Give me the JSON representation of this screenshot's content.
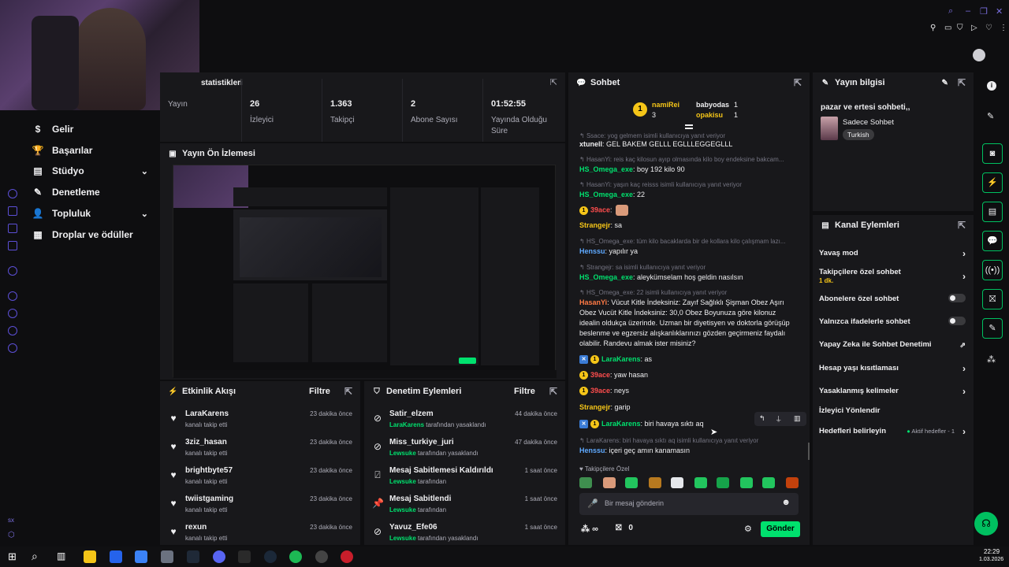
{
  "sidebar": {
    "items": [
      {
        "label": "Gelir",
        "icon": "dollar-icon"
      },
      {
        "label": "Başarılar",
        "icon": "trophy-icon"
      },
      {
        "label": "Stüdyo",
        "icon": "studio-icon"
      },
      {
        "label": "Denetleme",
        "icon": "wrench-icon"
      },
      {
        "label": "Topluluk",
        "icon": "person-icon"
      },
      {
        "label": "Droplar ve ödüller",
        "icon": "gift-icon"
      }
    ],
    "bottom_label": "sx"
  },
  "stats": {
    "title": "statistikleri",
    "items": [
      {
        "value": "",
        "label": "Yayın"
      },
      {
        "value": "26",
        "label": "İzleyici"
      },
      {
        "value": "1.363",
        "label": "Takipçi"
      },
      {
        "value": "2",
        "label": "Abone Sayısı"
      },
      {
        "value": "01:52:55",
        "label": "Yayında Olduğu Süre"
      }
    ]
  },
  "preview": {
    "title": "Yayın Ön İzlemesi"
  },
  "activity": {
    "title": "Etkinlik Akışı",
    "filter": "Filtre",
    "rows": [
      {
        "name": "LaraKarens",
        "sub": "kanalı takip etti",
        "time": "23 dakika önce"
      },
      {
        "name": "3ziz_hasan",
        "sub": "kanalı takip etti",
        "time": "23 dakika önce"
      },
      {
        "name": "brightbyte57",
        "sub": "kanalı takip etti",
        "time": "23 dakika önce"
      },
      {
        "name": "twiistgaming",
        "sub": "kanalı takip etti",
        "time": "23 dakika önce"
      },
      {
        "name": "rexun",
        "sub": "kanalı takip etti",
        "time": "23 dakika önce"
      }
    ]
  },
  "moderation": {
    "title": "Denetim Eylemleri",
    "filter": "Filtre",
    "rows": [
      {
        "name": "Satir_elzem",
        "actor": "LaraKarens",
        "rest": "tarafından yasaklandı",
        "time": "44 dakika önce",
        "icon": "ban-icon"
      },
      {
        "name": "Miss_turkiye_juri",
        "actor": "Lewsuke",
        "rest": "tarafından yasaklandı",
        "time": "47 dakika önce",
        "icon": "ban-icon"
      },
      {
        "name": "Mesaj Sabitlemesi Kaldırıldı",
        "actor": "Lewsuke",
        "rest": "tarafından",
        "time": "1 saat önce",
        "icon": "unpin-icon"
      },
      {
        "name": "Mesaj Sabitlendi",
        "actor": "Lewsuke",
        "rest": "tarafından",
        "time": "1 saat önce",
        "icon": "pin-icon"
      },
      {
        "name": "Yavuz_Efe06",
        "actor": "Lewsuke",
        "rest": "tarafından yasaklandı",
        "time": "1 saat önce",
        "icon": "ban-icon"
      }
    ]
  },
  "chat": {
    "title": "Sohbet",
    "leaderboard": [
      {
        "rank": "1",
        "name": "namiRei",
        "count": "3"
      },
      {
        "rank": "",
        "name": "babyodas",
        "count": "1"
      },
      {
        "rank": "",
        "name": "opakisu",
        "count": "1"
      }
    ],
    "messages": [
      {
        "type": "reply",
        "text": "Ssace: yog gelmem isimli kullanıcıya yanıt veriyor"
      },
      {
        "type": "msg",
        "user": "xtunell",
        "color": "#efeff1",
        "text": ": GEL BAKEM GELLL EGLLLEGGEGLLL"
      },
      {
        "type": "reply",
        "text": "HasanYi: reis kaç kilosun ayıp olmasında kilo boy endeksine bakcam..."
      },
      {
        "type": "msg",
        "user": "HS_Omega_exe",
        "color": "#00e16e",
        "text": ": boy 192 kilo 90"
      },
      {
        "type": "reply",
        "text": "HasanYi: yaşın kaç reisss isimli kullanıcıya yanıt veriyor"
      },
      {
        "type": "msg",
        "user": "HS_Omega_exe",
        "color": "#00e16e",
        "text": ": 22"
      },
      {
        "type": "msg",
        "user": "39ace",
        "color": "#ff4d4d",
        "text": ":",
        "badges": [
          "1"
        ]
      },
      {
        "type": "msg",
        "user": "Strangejr",
        "color": "#f5c518",
        "text": ": sa"
      },
      {
        "type": "reply",
        "text": "HS_Omega_exe: tüm kilo bacaklarda bir de kollara kilo çalışmam lazı..."
      },
      {
        "type": "msg",
        "user": "Henssu",
        "color": "#5ea9ff",
        "text": ": yapılır ya"
      },
      {
        "type": "reply",
        "text": "Strangejr: sa isimli kullanıcıya yanıt veriyor"
      },
      {
        "type": "msg",
        "user": "HS_Omega_exe",
        "color": "#00e16e",
        "text": ": aleykümselam hoş geldin nasılsın"
      },
      {
        "type": "reply",
        "text": "HS_Omega_exe: 22 isimli kullanıcıya yanıt veriyor"
      },
      {
        "type": "msg",
        "user": "HasanYi",
        "color": "#ff7a45",
        "text": ": Vücut Kitle İndeksiniz: Zayıf Sağlıklı Şişman Obez Aşırı"
      },
      {
        "type": "cont",
        "text": "Obez Vucüt Kitle İndeksiniz: 30,0 Obez Boyunuza göre kilonuz"
      },
      {
        "type": "cont",
        "text": "idealin oldukça üzerinde. Uzman bir diyetisyen ve doktorla görüşüp"
      },
      {
        "type": "cont",
        "text": "beslenme ve egzersiz alışkanlıklarınızı gözden geçirmeniz faydalı"
      },
      {
        "type": "cont",
        "text": "olabilir. Randevu almak ister misiniz?"
      },
      {
        "type": "msg",
        "user": "LaraKarens",
        "color": "#00e16e",
        "text": ": as",
        "badges": [
          "x",
          "1"
        ]
      },
      {
        "type": "msg",
        "user": "39ace",
        "color": "#ff4d4d",
        "text": ": yaw hasan",
        "badges": [
          "1"
        ]
      },
      {
        "type": "msg",
        "user": "39ace",
        "color": "#ff4d4d",
        "text": ": neys",
        "badges": [
          "1"
        ]
      },
      {
        "type": "msg",
        "user": "Strangejr",
        "color": "#f5c518",
        "text": ": garip"
      },
      {
        "type": "msg",
        "user": "LaraKarens",
        "color": "#00e16e",
        "text": ": biri havaya sıktı aq",
        "badges": [
          "x",
          "1"
        ]
      },
      {
        "type": "reply",
        "text": "LaraKarens: biri havaya sıktı aq isimli kullanıcıya yanıt veriyor"
      },
      {
        "type": "msg",
        "user": "Henssu",
        "color": "#5ea9ff",
        "text": ": içeri geç amın kanamasın"
      }
    ],
    "emote_section": "Takipçilere Özel",
    "input_placeholder": "Bir mesaj gönderin",
    "points": "∞",
    "gift_count": "0",
    "send_label": "Gönder"
  },
  "stream_info": {
    "title": "Yayın bilgisi",
    "stream_title": "pazar ve ertesi sohbeti,,",
    "category": "Sadece Sohbet",
    "tag": "Turkish"
  },
  "channel_actions": {
    "title": "Kanal Eylemleri",
    "items": [
      {
        "label": "Yavaş mod",
        "kind": "chevron"
      },
      {
        "label": "Takipçilere özel sohbet",
        "sub": "1 dk.",
        "kind": "chevron"
      },
      {
        "label": "Abonelere özel sohbet",
        "kind": "toggle"
      },
      {
        "label": "Yalnızca ifadelerle sohbet",
        "kind": "toggle"
      },
      {
        "label": "Yapay Zeka ile Sohbet Denetimi",
        "kind": "external"
      },
      {
        "label": "Hesap yaşı kısıtlaması",
        "kind": "chevron"
      },
      {
        "label": "Yasaklanmış kelimeler",
        "kind": "chevron"
      },
      {
        "label": "İzleyici Yönlendir",
        "kind": "none"
      },
      {
        "label": "Hedefleri belirleyin",
        "extra": "Aktif hedefler - 1",
        "kind": "chevron"
      }
    ]
  },
  "taskbar": {
    "time": "22:29",
    "date": "1.03.2026"
  },
  "colors": {
    "accent": "#00e16e",
    "panel": "#18181b",
    "bg": "#0e0e10"
  }
}
